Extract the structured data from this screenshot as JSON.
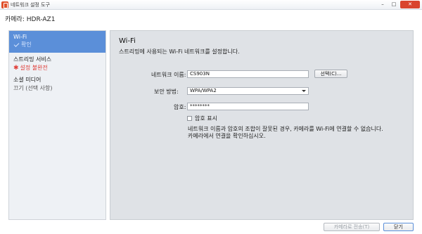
{
  "window": {
    "title": "네트워크 설정 도구",
    "minimize_glyph": "–",
    "maximize_glyph": "□",
    "close_glyph": "✕"
  },
  "camera": {
    "label": "카메라:",
    "model": "HDR-AZ1"
  },
  "sidebar": {
    "items": [
      {
        "title": "Wi-Fi",
        "status": "확인",
        "status_icon": "check-icon",
        "active": true
      },
      {
        "title": "스트리밍 서비스",
        "status": "설정 불완전",
        "status_icon": "asterisk-icon",
        "active": false
      },
      {
        "title": "소셜 미디어",
        "status": "끄기 (선택 사항)",
        "active": false
      }
    ],
    "warn_glyph": "✱"
  },
  "main": {
    "title": "Wi-Fi",
    "description": "스트리밍에 사용되는 Wi-Fi 네트워크를 설정합니다.",
    "network_name_label": "네트워크 이름:",
    "network_name_value": "CS903N",
    "select_button_label": "선택(C)...",
    "security_label": "보안 방법:",
    "security_value": "WPA/WPA2",
    "password_label": "암호:",
    "password_value": "********",
    "show_password_label": "암호 표시",
    "note_line1": "네트워크 이름과 암호의 조합이 잘못된 경우, 카메라를 Wi-Fi에 연결할 수 없습니다.",
    "note_line2": "카메라에서 연결을 확인하십시오."
  },
  "footer": {
    "transfer_label": "카메라로 전송(T)",
    "close_label": "닫기"
  },
  "colors": {
    "accent": "#5b8fd9",
    "warning": "#e0403a",
    "panel_bg": "#dfe2e6",
    "close_button": "#d9442e"
  }
}
